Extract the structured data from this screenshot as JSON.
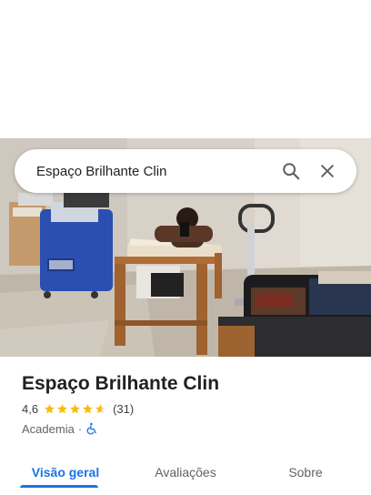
{
  "search": {
    "query": "Espaço Brilhante Clin",
    "search_icon": "search-icon",
    "close_icon": "close-icon"
  },
  "photo": {
    "description_icon": "place-photo"
  },
  "place": {
    "name": "Espaço Brilhante Clin",
    "rating": "4,6",
    "rating_value": 4.6,
    "stars_max": 5,
    "review_count": "(31)",
    "category": "Academia",
    "separator": "·",
    "accessibility_icon": "wheelchair-icon"
  },
  "tabs": [
    {
      "label": "Visão geral",
      "active": true
    },
    {
      "label": "Avaliações",
      "active": false
    },
    {
      "label": "Sobre",
      "active": false
    }
  ],
  "colors": {
    "accent": "#1a73e8",
    "star": "#fbbc04",
    "text_primary": "#202124",
    "text_secondary": "#5f6368"
  }
}
